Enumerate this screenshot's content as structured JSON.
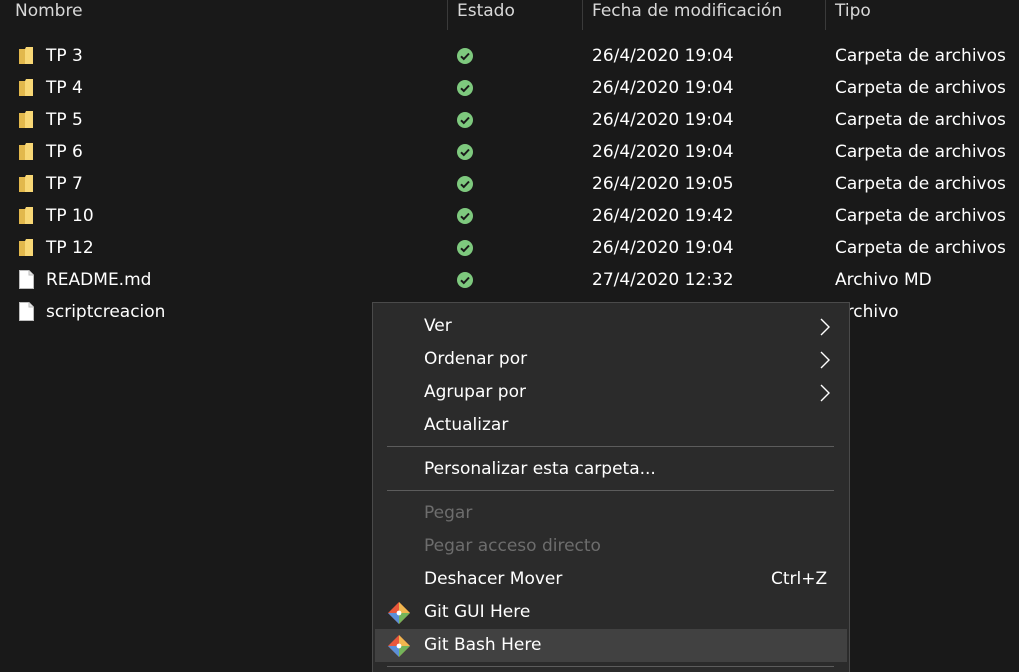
{
  "columns": {
    "name": "Nombre",
    "status": "Estado",
    "date": "Fecha de modificación",
    "type": "Tipo"
  },
  "files": [
    {
      "icon": "folder-icon",
      "name": "TP 3",
      "status": "synced-check-icon",
      "date": "26/4/2020 19:04",
      "type": "Carpeta de archivos"
    },
    {
      "icon": "folder-icon",
      "name": "TP 4",
      "status": "synced-check-icon",
      "date": "26/4/2020 19:04",
      "type": "Carpeta de archivos"
    },
    {
      "icon": "folder-icon",
      "name": "TP 5",
      "status": "synced-check-icon",
      "date": "26/4/2020 19:04",
      "type": "Carpeta de archivos"
    },
    {
      "icon": "folder-icon",
      "name": "TP 6",
      "status": "synced-check-icon",
      "date": "26/4/2020 19:04",
      "type": "Carpeta de archivos"
    },
    {
      "icon": "folder-icon",
      "name": "TP 7",
      "status": "synced-check-icon",
      "date": "26/4/2020 19:05",
      "type": "Carpeta de archivos"
    },
    {
      "icon": "folder-icon",
      "name": "TP 10",
      "status": "synced-check-icon",
      "date": "26/4/2020 19:42",
      "type": "Carpeta de archivos"
    },
    {
      "icon": "folder-icon",
      "name": "TP 12",
      "status": "synced-check-icon",
      "date": "26/4/2020 19:04",
      "type": "Carpeta de archivos"
    },
    {
      "icon": "file-icon",
      "name": "README.md",
      "status": "synced-check-icon",
      "date": "27/4/2020 12:32",
      "type": "Archivo MD"
    },
    {
      "icon": "file-icon",
      "name": "scriptcreacion",
      "status": "",
      "date": "",
      "type": "Archivo"
    }
  ],
  "context_menu": {
    "view": "Ver",
    "sort_by": "Ordenar por",
    "group_by": "Agrupar por",
    "refresh": "Actualizar",
    "customize": "Personalizar esta carpeta...",
    "paste": "Pegar",
    "paste_shortcut": "Pegar acceso directo",
    "undo_move": "Deshacer Mover",
    "undo_move_shortcut": "Ctrl+Z",
    "git_gui": "Git GUI Here",
    "git_bash": "Git Bash Here"
  },
  "colors": {
    "background": "#191919",
    "menu_background": "#2b2b2b",
    "menu_hover": "#414141",
    "folder_yellow": "#f8d775",
    "sync_green": "#7ec97e",
    "disabled_text": "#6d6d6d"
  }
}
